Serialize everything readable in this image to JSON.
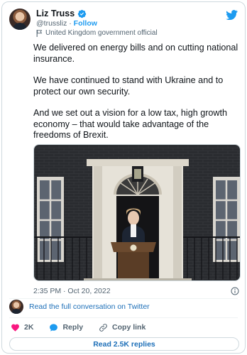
{
  "author": {
    "name": "Liz Truss",
    "handle": "@trussliz",
    "separator": "·",
    "follow_label": "Follow",
    "account_label": "United Kingdom government official"
  },
  "tweet": {
    "paragraphs": [
      "We delivered on energy bills and on cutting national insurance.",
      "We have continued to stand with Ukraine and to protect our own security.",
      "And we set out a vision for a low tax, high growth economy – that would take advantage of the freedoms of Brexit."
    ],
    "timestamp": "2:35 PM · Oct 20, 2022"
  },
  "conversation_link": "Read the full conversation on Twitter",
  "actions": {
    "likes": "2K",
    "reply_label": "Reply",
    "copy_link_label": "Copy link"
  },
  "replies_button": "Read 2.5K replies",
  "icons": {
    "verified": "verified-badge-icon",
    "platform": "twitter-bird-icon",
    "government": "flag-icon",
    "info": "info-icon",
    "like": "heart-icon",
    "reply": "reply-bubble-icon",
    "link": "link-icon"
  },
  "colors": {
    "brand_blue": "#1d9bf0",
    "link_blue": "#1d6fb8",
    "like_red": "#f91880",
    "secondary_text": "#536471",
    "border": "#cfd9de"
  }
}
